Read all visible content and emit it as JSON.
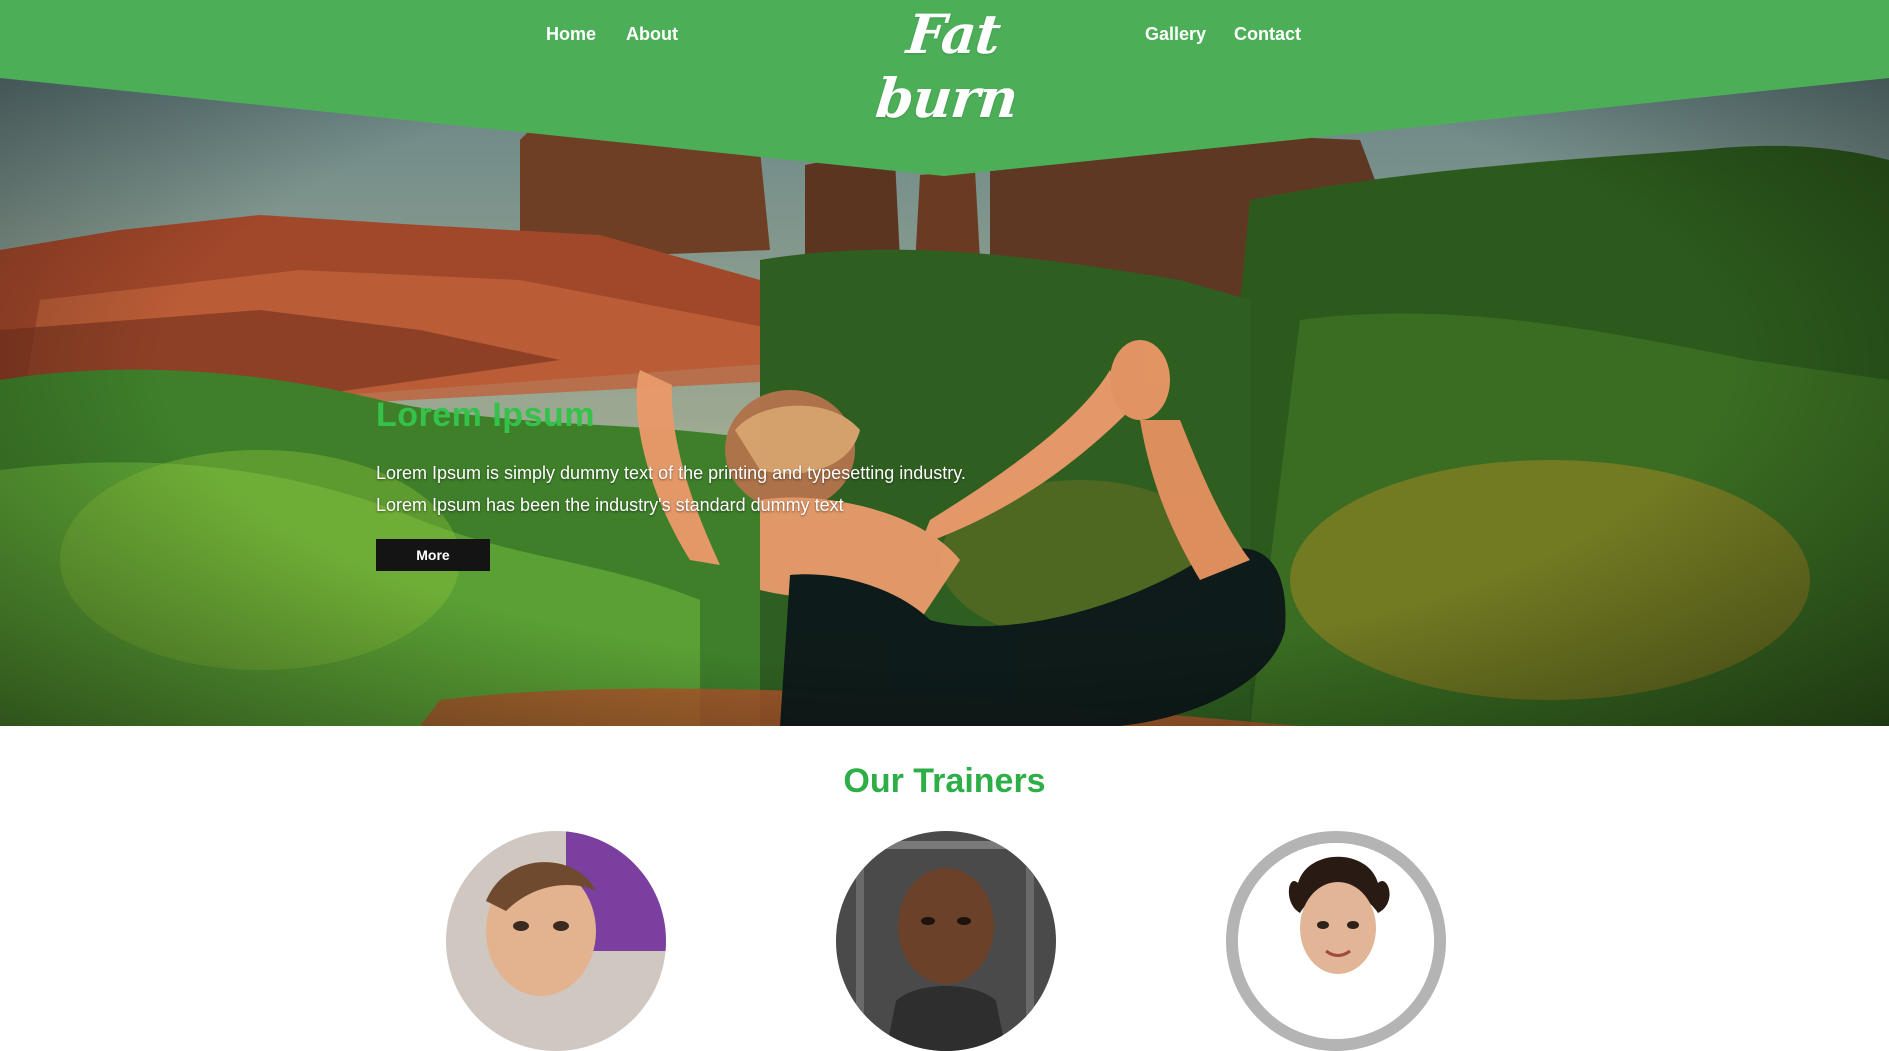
{
  "header": {
    "logo": "Fat burn",
    "nav_left": [
      {
        "label": "Home"
      },
      {
        "label": "About"
      }
    ],
    "nav_right": [
      {
        "label": "Gallery"
      },
      {
        "label": "Contact"
      }
    ]
  },
  "hero": {
    "title": "Lorem Ipsum",
    "line1": "Lorem Ipsum is simply dummy text of the printing and typesetting industry.",
    "line2": "Lorem Ipsum has been the industry's standard dummy text",
    "button_label": "More",
    "image": "yoga-pose-canyon-photo"
  },
  "trainers": {
    "title": "Our Trainers",
    "items": [
      {
        "image": "trainer-woman-portrait"
      },
      {
        "image": "trainer-man-portrait"
      },
      {
        "image": "trainer-woman-dark-hair-portrait"
      }
    ]
  },
  "colors": {
    "brand_green": "#4caf58",
    "accent_green": "#34c24a",
    "button_dark": "#141414"
  }
}
